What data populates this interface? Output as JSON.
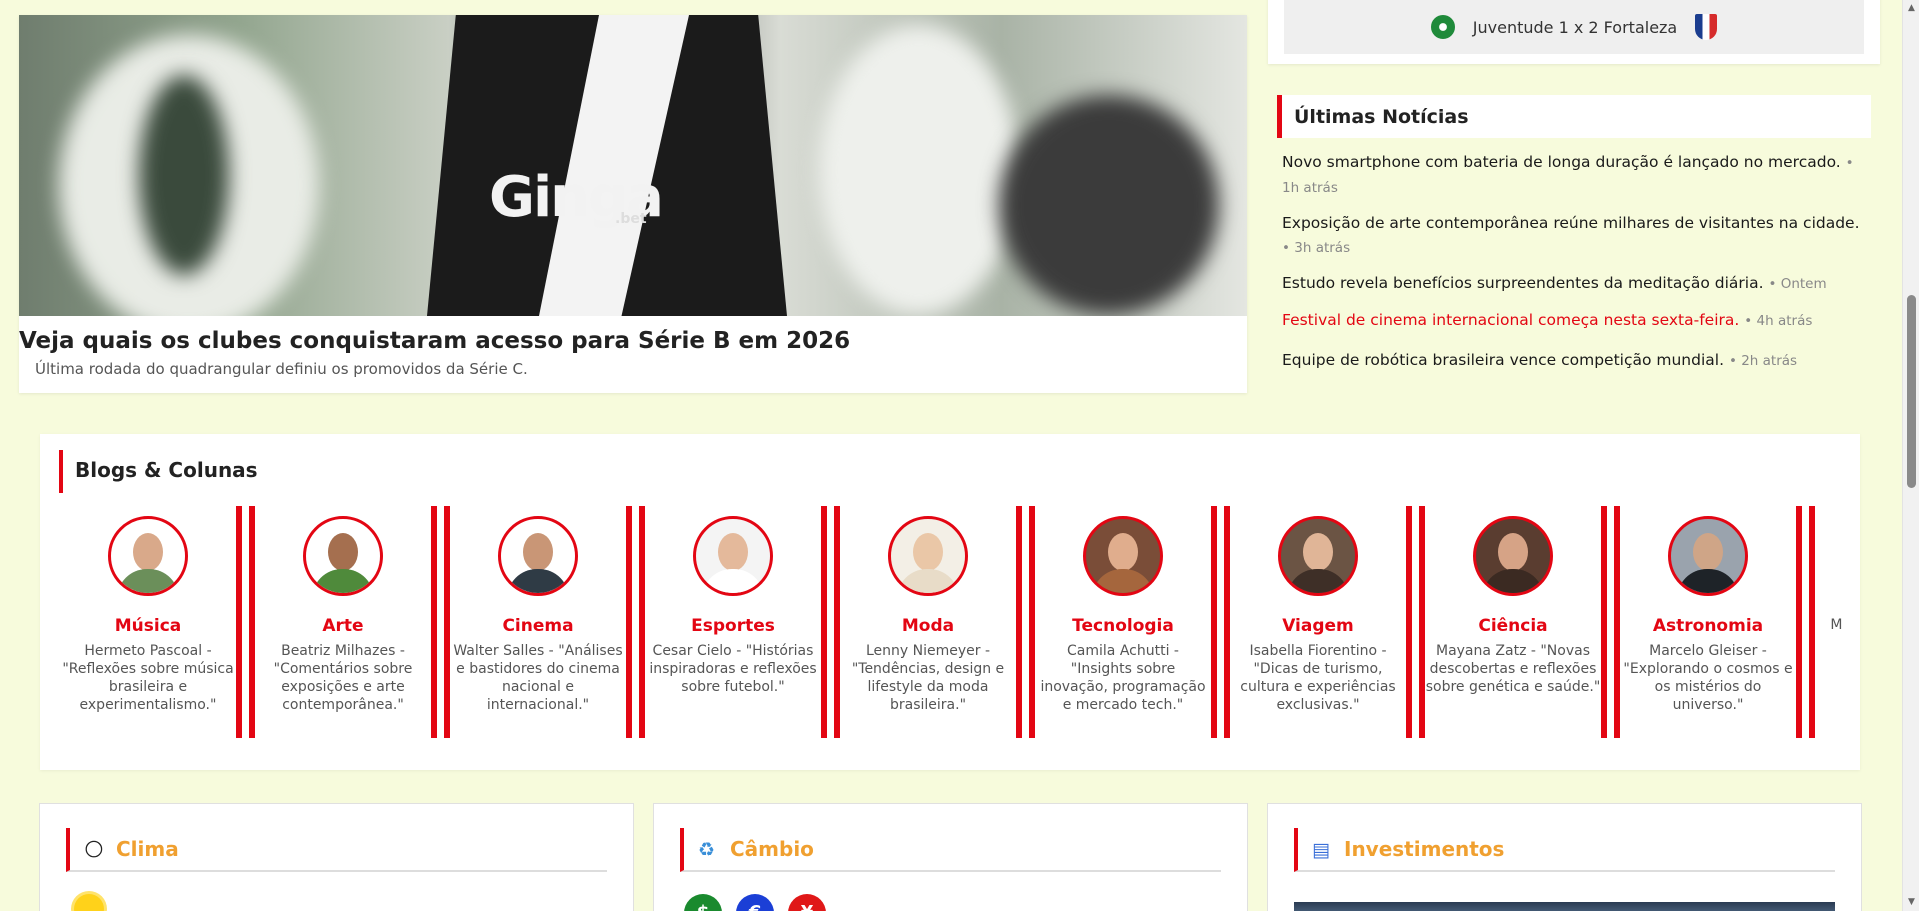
{
  "hero": {
    "title": "Veja quais os clubes conquistaram acesso para Série B em 2026",
    "subtitle": "Última rodada do quadrangular definiu os promovidos da Série C.",
    "image_sponsor": "Ginga",
    "image_sponsor_sub": ".bet"
  },
  "score": {
    "text": "Juventude 1 x 2 Fortaleza",
    "home_logo": "juventude-logo",
    "away_logo": "fortaleza-logo"
  },
  "latest_news": {
    "title": "Últimas Notícias",
    "items": [
      {
        "text": "Novo smartphone com bateria de longa duração é lançado no mercado.",
        "time": "• 1h atrás",
        "highlight": false
      },
      {
        "text": "Exposição de arte contemporânea reúne milhares de visitantes na cidade.",
        "time": "• 3h atrás",
        "highlight": false
      },
      {
        "text": "Estudo revela benefícios surpreendentes da meditação diária.",
        "time": "• Ontem",
        "highlight": false
      },
      {
        "text": "Festival de cinema internacional começa nesta sexta-feira.",
        "time": "• 4h atrás",
        "highlight": true
      },
      {
        "text": "Equipe de robótica brasileira vence competição mundial.",
        "time": "• 2h atrás",
        "highlight": false
      }
    ]
  },
  "blogs": {
    "title": "Blogs & Colunas",
    "items": [
      {
        "category": "Música",
        "desc": "Hermeto Pascoal - \"Reflexões sobre música brasileira e experimentalismo.\""
      },
      {
        "category": "Arte",
        "desc": "Beatriz Milhazes - \"Comentários sobre exposições e arte contemporânea.\""
      },
      {
        "category": "Cinema",
        "desc": "Walter Salles - \"Análises e bastidores do cinema nacional e internacional.\""
      },
      {
        "category": "Esportes",
        "desc": "Cesar Cielo - \"Histórias inspiradoras e reflexões sobre futebol.\""
      },
      {
        "category": "Moda",
        "desc": "Lenny Niemeyer - \"Tendências, design e lifestyle da moda brasileira.\""
      },
      {
        "category": "Tecnologia",
        "desc": "Camila Achutti - \"Insights sobre inovação, programação e mercado tech.\""
      },
      {
        "category": "Viagem",
        "desc": "Isabella Fiorentino - \"Dicas de turismo, cultura e experiências exclusivas.\""
      },
      {
        "category": "Ciência",
        "desc": "Mayana Zatz - \"Novas descobertas e reflexões sobre genética e saúde.\""
      },
      {
        "category": "Astronomia",
        "desc": "Marcelo Gleiser - \"Explorando o cosmos e os mistérios do universo.\""
      },
      {
        "category": "",
        "desc": "Marina sobre p e sus"
      }
    ]
  },
  "widgets": {
    "weather": {
      "title": "Clima",
      "icon": "sun-icon"
    },
    "exchange": {
      "title": "Câmbio",
      "icon": "exchange-icon",
      "coins": [
        "$",
        "€",
        "¥"
      ]
    },
    "investments": {
      "title": "Investimentos",
      "icon": "chart-icon"
    }
  },
  "colors": {
    "accent": "#e30613",
    "widget_title": "#f0a030",
    "background": "#f7fbdc"
  }
}
